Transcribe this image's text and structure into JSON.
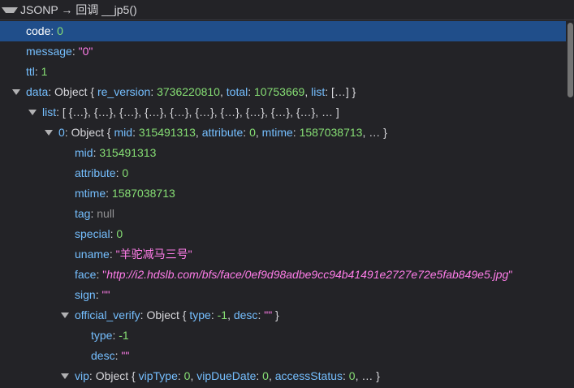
{
  "header": {
    "title": "JSONP → 回调 __jp5()"
  },
  "rows": [
    {
      "indent": 0,
      "toggle": false,
      "key": "code",
      "parts": [
        {
          "t": "num",
          "v": "0"
        }
      ],
      "selected": true
    },
    {
      "indent": 0,
      "toggle": false,
      "key": "message",
      "parts": [
        {
          "t": "str",
          "v": "\"0\""
        }
      ]
    },
    {
      "indent": 0,
      "toggle": false,
      "key": "ttl",
      "parts": [
        {
          "t": "num",
          "v": "1"
        }
      ]
    },
    {
      "indent": 0,
      "toggle": true,
      "key": "data",
      "parts": [
        {
          "t": "pre",
          "v": "Object { "
        },
        {
          "t": "key",
          "v": "re_version"
        },
        {
          "t": "pre",
          "v": ": "
        },
        {
          "t": "num",
          "v": "3736220810"
        },
        {
          "t": "pre",
          "v": ", "
        },
        {
          "t": "key",
          "v": "total"
        },
        {
          "t": "pre",
          "v": ": "
        },
        {
          "t": "num",
          "v": "10753669"
        },
        {
          "t": "pre",
          "v": ", "
        },
        {
          "t": "key",
          "v": "list"
        },
        {
          "t": "pre",
          "v": ": […] }"
        }
      ]
    },
    {
      "indent": 1,
      "toggle": true,
      "key": "list",
      "parts": [
        {
          "t": "pre",
          "v": "[ {…}, {…}, {…}, {…}, {…}, {…}, {…}, {…}, {…}, {…}, … ]"
        }
      ]
    },
    {
      "indent": 2,
      "toggle": true,
      "key": "0",
      "parts": [
        {
          "t": "pre",
          "v": "Object { "
        },
        {
          "t": "key",
          "v": "mid"
        },
        {
          "t": "pre",
          "v": ": "
        },
        {
          "t": "num",
          "v": "315491313"
        },
        {
          "t": "pre",
          "v": ", "
        },
        {
          "t": "key",
          "v": "attribute"
        },
        {
          "t": "pre",
          "v": ": "
        },
        {
          "t": "num",
          "v": "0"
        },
        {
          "t": "pre",
          "v": ", "
        },
        {
          "t": "key",
          "v": "mtime"
        },
        {
          "t": "pre",
          "v": ": "
        },
        {
          "t": "num",
          "v": "1587038713"
        },
        {
          "t": "pre",
          "v": ", … }"
        }
      ]
    },
    {
      "indent": 3,
      "toggle": false,
      "key": "mid",
      "parts": [
        {
          "t": "num",
          "v": "315491313"
        }
      ]
    },
    {
      "indent": 3,
      "toggle": false,
      "key": "attribute",
      "parts": [
        {
          "t": "num",
          "v": "0"
        }
      ]
    },
    {
      "indent": 3,
      "toggle": false,
      "key": "mtime",
      "parts": [
        {
          "t": "num",
          "v": "1587038713"
        }
      ]
    },
    {
      "indent": 3,
      "toggle": false,
      "key": "tag",
      "parts": [
        {
          "t": "nul",
          "v": "null"
        }
      ]
    },
    {
      "indent": 3,
      "toggle": false,
      "key": "special",
      "parts": [
        {
          "t": "num",
          "v": "0"
        }
      ]
    },
    {
      "indent": 3,
      "toggle": false,
      "key": "uname",
      "parts": [
        {
          "t": "str",
          "v": "\"羊驼减马三号\""
        }
      ]
    },
    {
      "indent": 3,
      "toggle": false,
      "key": "face",
      "parts": [
        {
          "t": "str",
          "v": "\""
        },
        {
          "t": "str url",
          "v": "http://i2.hdslb.com/bfs/face/0ef9d98adbe9cc94b41491e2727e72e5fab849e5.jpg"
        },
        {
          "t": "str",
          "v": "\""
        }
      ]
    },
    {
      "indent": 3,
      "toggle": false,
      "key": "sign",
      "parts": [
        {
          "t": "str",
          "v": "\"\""
        }
      ]
    },
    {
      "indent": 3,
      "toggle": true,
      "key": "official_verify",
      "parts": [
        {
          "t": "pre",
          "v": "Object { "
        },
        {
          "t": "key",
          "v": "type"
        },
        {
          "t": "pre",
          "v": ": "
        },
        {
          "t": "num",
          "v": "-1"
        },
        {
          "t": "pre",
          "v": ", "
        },
        {
          "t": "key",
          "v": "desc"
        },
        {
          "t": "pre",
          "v": ": "
        },
        {
          "t": "str",
          "v": "\"\""
        },
        {
          "t": "pre",
          "v": " }"
        }
      ]
    },
    {
      "indent": 4,
      "toggle": false,
      "key": "type",
      "parts": [
        {
          "t": "num",
          "v": "-1"
        }
      ]
    },
    {
      "indent": 4,
      "toggle": false,
      "key": "desc",
      "parts": [
        {
          "t": "str",
          "v": "\"\""
        }
      ]
    },
    {
      "indent": 3,
      "toggle": true,
      "key": "vip",
      "parts": [
        {
          "t": "pre",
          "v": "Object { "
        },
        {
          "t": "key",
          "v": "vipType"
        },
        {
          "t": "pre",
          "v": ": "
        },
        {
          "t": "num",
          "v": "0"
        },
        {
          "t": "pre",
          "v": ", "
        },
        {
          "t": "key",
          "v": "vipDueDate"
        },
        {
          "t": "pre",
          "v": ": "
        },
        {
          "t": "num",
          "v": "0"
        },
        {
          "t": "pre",
          "v": ", "
        },
        {
          "t": "key",
          "v": "accessStatus"
        },
        {
          "t": "pre",
          "v": ": "
        },
        {
          "t": "num",
          "v": "0"
        },
        {
          "t": "pre",
          "v": ", … }"
        }
      ]
    }
  ]
}
